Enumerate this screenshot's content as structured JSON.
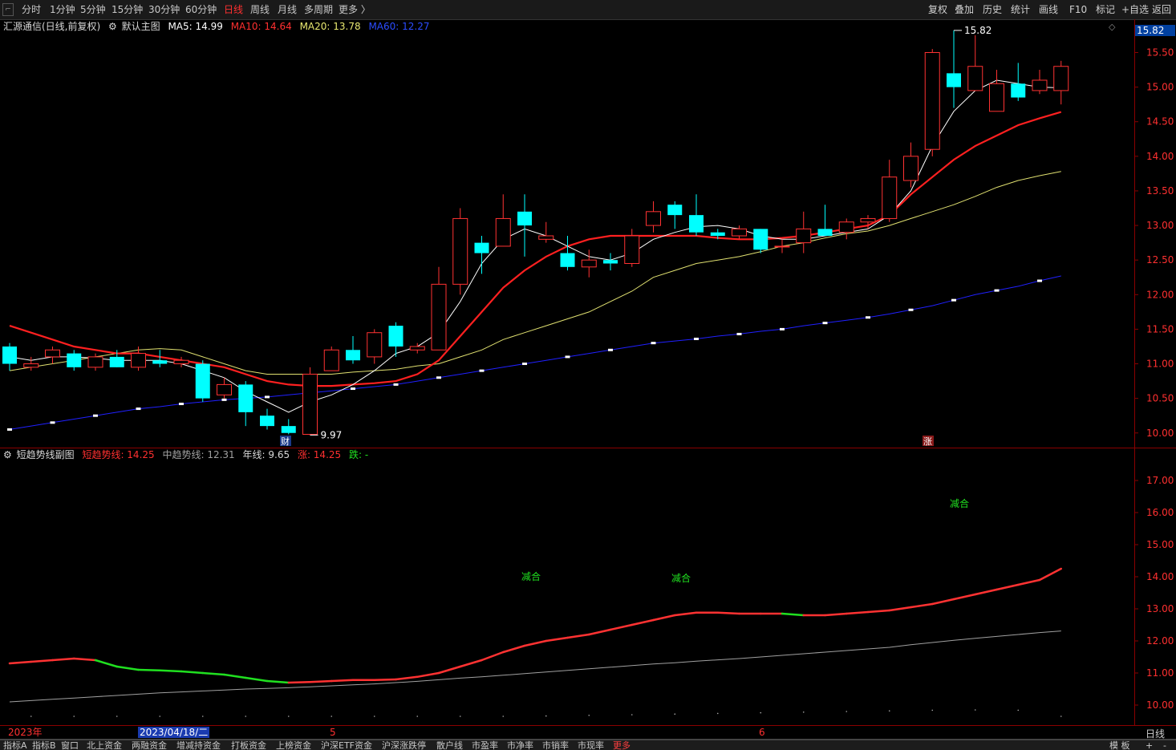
{
  "periods": [
    "分时",
    "1分钟",
    "5分钟",
    "15分钟",
    "30分钟",
    "60分钟",
    "日线",
    "周线",
    "月线",
    "多周期",
    "更多 〉"
  ],
  "active_period": "日线",
  "tools": [
    "复权",
    "叠加",
    "历史",
    "统计",
    "画线",
    "F10",
    "标记",
    "+自选",
    "返回"
  ],
  "main_info": {
    "title": "汇源通信(日线,前复权)",
    "template": "默认主图",
    "ma5": "MA5: 14.99",
    "ma10": "MA10: 14.64",
    "ma20": "MA20: 13.78",
    "ma60": "MA60: 12.27"
  },
  "sub_info": {
    "title": "短趋势线副图",
    "short": "短趋势线: 14.25",
    "mid": "中趋势线: 12.31",
    "year": "年线: 9.65",
    "up": "涨: 14.25",
    "down": "跌: -"
  },
  "last_price": "15.82",
  "high_mark": "15.82",
  "low_mark": "9.97",
  "event_markers": [
    {
      "label": "财",
      "type": "financial"
    },
    {
      "label": "涨",
      "type": "limit-up"
    }
  ],
  "sub_annotations": [
    "减合",
    "减合",
    "减合"
  ],
  "colors": {
    "up": "#ff3232",
    "down": "#00ffff",
    "ma5": "#ffffff",
    "ma10": "#ff2020",
    "ma20": "#e0e070",
    "ma60": "#2020ff",
    "green": "#20e020",
    "grid": "#8b0000"
  },
  "main_axis_ticks": [
    "15.50",
    "15.00",
    "14.50",
    "14.00",
    "13.50",
    "13.00",
    "12.50",
    "12.00",
    "11.50",
    "11.00",
    "10.50",
    "10.00"
  ],
  "sub_axis_ticks": [
    "17.00",
    "16.00",
    "15.00",
    "14.00",
    "13.00",
    "12.00",
    "11.00",
    "10.00"
  ],
  "date_axis": {
    "year": "2023年",
    "cursor": "2023/04/18/二",
    "month5": "5",
    "month6": "6"
  },
  "period_label": "日线",
  "bottom_tabs": [
    "指标A",
    "指标B",
    "窗口",
    "北上资金",
    "两融资金",
    "增减持资金",
    "打板资金",
    "上榜资金",
    "沪深ETF资金",
    "沪深涨跌停",
    "散户线",
    "市盈率",
    "市净率",
    "市销率",
    "市现率",
    "更多"
  ],
  "bottom_right": [
    "模 板",
    "+",
    "-"
  ],
  "chart_data": [
    {
      "type": "candlestick",
      "title": "汇源通信(日线,前复权)",
      "ylim": [
        9.8,
        15.9
      ],
      "candles": [
        {
          "o": 11.25,
          "c": 11.0,
          "h": 11.3,
          "l": 10.9
        },
        {
          "o": 10.95,
          "c": 11.0,
          "h": 11.1,
          "l": 10.9
        },
        {
          "o": 11.1,
          "c": 11.2,
          "h": 11.25,
          "l": 11.0
        },
        {
          "o": 11.15,
          "c": 10.95,
          "h": 11.2,
          "l": 10.9
        },
        {
          "o": 10.95,
          "c": 11.1,
          "h": 11.15,
          "l": 10.9
        },
        {
          "o": 11.1,
          "c": 10.95,
          "h": 11.2,
          "l": 10.95
        },
        {
          "o": 10.95,
          "c": 11.15,
          "h": 11.25,
          "l": 10.9
        },
        {
          "o": 11.05,
          "c": 11.0,
          "h": 11.2,
          "l": 10.95
        },
        {
          "o": 11.0,
          "c": 11.05,
          "h": 11.1,
          "l": 10.95
        },
        {
          "o": 11.0,
          "c": 10.5,
          "h": 11.05,
          "l": 10.45
        },
        {
          "o": 10.55,
          "c": 10.7,
          "h": 10.8,
          "l": 10.5
        },
        {
          "o": 10.7,
          "c": 10.3,
          "h": 10.75,
          "l": 10.1
        },
        {
          "o": 10.25,
          "c": 10.1,
          "h": 10.35,
          "l": 10.05
        },
        {
          "o": 10.1,
          "c": 10.0,
          "h": 10.2,
          "l": 9.98
        },
        {
          "o": 9.98,
          "c": 10.85,
          "h": 10.95,
          "l": 9.97
        },
        {
          "o": 10.9,
          "c": 11.2,
          "h": 11.25,
          "l": 10.9
        },
        {
          "o": 11.2,
          "c": 11.05,
          "h": 11.4,
          "l": 11.0
        },
        {
          "o": 11.1,
          "c": 11.45,
          "h": 11.5,
          "l": 11.0
        },
        {
          "o": 11.55,
          "c": 11.25,
          "h": 11.6,
          "l": 11.1
        },
        {
          "o": 11.2,
          "c": 11.25,
          "h": 11.3,
          "l": 11.15
        },
        {
          "o": 11.2,
          "c": 12.15,
          "h": 12.4,
          "l": 11.2
        },
        {
          "o": 12.15,
          "c": 13.1,
          "h": 13.25,
          "l": 12.0
        },
        {
          "o": 12.75,
          "c": 12.6,
          "h": 12.85,
          "l": 12.3
        },
        {
          "o": 12.7,
          "c": 13.1,
          "h": 13.45,
          "l": 12.7
        },
        {
          "o": 13.2,
          "c": 13.0,
          "h": 13.45,
          "l": 12.55
        },
        {
          "o": 12.8,
          "c": 12.85,
          "h": 13.05,
          "l": 12.75
        },
        {
          "o": 12.6,
          "c": 12.4,
          "h": 12.85,
          "l": 12.35
        },
        {
          "o": 12.4,
          "c": 12.5,
          "h": 12.65,
          "l": 12.25
        },
        {
          "o": 12.5,
          "c": 12.45,
          "h": 12.6,
          "l": 12.35
        },
        {
          "o": 12.45,
          "c": 12.85,
          "h": 12.95,
          "l": 12.4
        },
        {
          "o": 13.0,
          "c": 13.2,
          "h": 13.35,
          "l": 12.9
        },
        {
          "o": 13.3,
          "c": 13.15,
          "h": 13.35,
          "l": 12.95
        },
        {
          "o": 13.15,
          "c": 12.9,
          "h": 13.45,
          "l": 12.85
        },
        {
          "o": 12.9,
          "c": 12.85,
          "h": 12.95,
          "l": 12.8
        },
        {
          "o": 12.85,
          "c": 12.95,
          "h": 13.0,
          "l": 12.8
        },
        {
          "o": 12.95,
          "c": 12.65,
          "h": 12.95,
          "l": 12.6
        },
        {
          "o": 12.7,
          "c": 12.7,
          "h": 12.8,
          "l": 12.6
        },
        {
          "o": 12.75,
          "c": 12.95,
          "h": 13.2,
          "l": 12.6
        },
        {
          "o": 12.95,
          "c": 12.85,
          "h": 13.3,
          "l": 12.85
        },
        {
          "o": 12.9,
          "c": 13.05,
          "h": 13.1,
          "l": 12.8
        },
        {
          "o": 13.05,
          "c": 13.1,
          "h": 13.15,
          "l": 12.95
        },
        {
          "o": 13.1,
          "c": 13.7,
          "h": 13.95,
          "l": 13.05
        },
        {
          "o": 13.65,
          "c": 14.0,
          "h": 14.2,
          "l": 13.55
        },
        {
          "o": 14.1,
          "c": 15.5,
          "h": 15.55,
          "l": 14.0
        },
        {
          "o": 15.2,
          "c": 15.0,
          "h": 15.82,
          "l": 14.7
        },
        {
          "o": 14.95,
          "c": 15.3,
          "h": 15.75,
          "l": 14.95
        },
        {
          "o": 14.65,
          "c": 15.05,
          "h": 15.25,
          "l": 14.65
        },
        {
          "o": 15.05,
          "c": 14.85,
          "h": 15.35,
          "l": 14.8
        },
        {
          "o": 14.95,
          "c": 15.1,
          "h": 15.25,
          "l": 14.9
        },
        {
          "o": 14.95,
          "c": 15.3,
          "h": 15.38,
          "l": 14.75
        }
      ],
      "ma5": [
        11.1,
        11.05,
        11.1,
        11.1,
        11.08,
        11.05,
        11.05,
        11.05,
        11.0,
        10.9,
        10.8,
        10.6,
        10.45,
        10.3,
        10.45,
        10.55,
        10.7,
        10.9,
        11.15,
        11.25,
        11.45,
        11.9,
        12.45,
        12.8,
        12.95,
        12.85,
        12.7,
        12.55,
        12.5,
        12.6,
        12.8,
        12.9,
        12.98,
        13.0,
        12.95,
        12.85,
        12.8,
        12.8,
        12.85,
        12.9,
        12.95,
        13.15,
        13.5,
        14.15,
        14.65,
        14.95,
        15.1,
        15.05,
        15.0,
        14.99
      ],
      "ma10": [
        11.55,
        11.45,
        11.35,
        11.25,
        11.2,
        11.15,
        11.15,
        11.1,
        11.05,
        11.0,
        10.95,
        10.85,
        10.75,
        10.7,
        10.68,
        10.68,
        10.7,
        10.72,
        10.75,
        10.85,
        11.05,
        11.4,
        11.75,
        12.1,
        12.35,
        12.55,
        12.7,
        12.8,
        12.85,
        12.85,
        12.85,
        12.85,
        12.85,
        12.82,
        12.8,
        12.8,
        12.82,
        12.85,
        12.9,
        12.95,
        13.0,
        13.15,
        13.45,
        13.7,
        13.95,
        14.15,
        14.3,
        14.45,
        14.55,
        14.64
      ],
      "ma20": [
        10.9,
        10.95,
        11.0,
        11.05,
        11.1,
        11.15,
        11.2,
        11.22,
        11.2,
        11.1,
        11.0,
        10.9,
        10.85,
        10.85,
        10.85,
        10.85,
        10.88,
        10.9,
        10.92,
        10.97,
        11.0,
        11.1,
        11.2,
        11.35,
        11.45,
        11.55,
        11.65,
        11.75,
        11.9,
        12.05,
        12.25,
        12.35,
        12.45,
        12.5,
        12.55,
        12.62,
        12.7,
        12.75,
        12.82,
        12.88,
        12.92,
        13.0,
        13.1,
        13.2,
        13.3,
        13.42,
        13.55,
        13.65,
        13.72,
        13.78
      ],
      "ma60": [
        10.05,
        10.1,
        10.15,
        10.2,
        10.25,
        10.3,
        10.35,
        10.38,
        10.42,
        10.45,
        10.48,
        10.5,
        10.52,
        10.55,
        10.58,
        10.61,
        10.64,
        10.67,
        10.7,
        10.75,
        10.8,
        10.85,
        10.9,
        10.95,
        11.0,
        11.05,
        11.1,
        11.15,
        11.2,
        11.25,
        11.3,
        11.33,
        11.36,
        11.4,
        11.43,
        11.47,
        11.5,
        11.55,
        11.59,
        11.63,
        11.67,
        11.72,
        11.78,
        11.84,
        11.92,
        12.0,
        12.06,
        12.12,
        12.2,
        12.27
      ]
    },
    {
      "type": "line",
      "title": "短趋势线副图",
      "ylim": [
        9.6,
        17.6
      ],
      "series": [
        {
          "name": "短趋势线",
          "values": [
            11.3,
            11.35,
            11.4,
            11.45,
            11.4,
            11.2,
            11.1,
            11.08,
            11.05,
            11.0,
            10.95,
            10.85,
            10.75,
            10.7,
            10.72,
            10.75,
            10.78,
            10.78,
            10.8,
            10.88,
            11.0,
            11.2,
            11.4,
            11.65,
            11.85,
            12.0,
            12.1,
            12.2,
            12.35,
            12.5,
            12.65,
            12.8,
            12.88,
            12.88,
            12.85,
            12.85,
            12.85,
            12.8,
            12.8,
            12.85,
            12.9,
            12.95,
            13.05,
            13.15,
            13.3,
            13.45,
            13.6,
            13.75,
            13.9,
            14.25
          ],
          "down_ranges": [
            [
              4,
              13
            ],
            [
              36,
              37
            ]
          ]
        },
        {
          "name": "中趋势线",
          "values": [
            10.1,
            10.14,
            10.18,
            10.22,
            10.26,
            10.3,
            10.34,
            10.38,
            10.41,
            10.44,
            10.47,
            10.5,
            10.52,
            10.54,
            10.57,
            10.6,
            10.63,
            10.66,
            10.7,
            10.74,
            10.79,
            10.84,
            10.88,
            10.93,
            10.98,
            11.03,
            11.08,
            11.13,
            11.18,
            11.23,
            11.28,
            11.32,
            11.37,
            11.41,
            11.45,
            11.5,
            11.55,
            11.6,
            11.65,
            11.7,
            11.75,
            11.8,
            11.88,
            11.95,
            12.02,
            12.08,
            12.14,
            12.2,
            12.26,
            12.31
          ]
        },
        {
          "name": "年线",
          "values": [
            9.2,
            9.22,
            9.24,
            9.26,
            9.28,
            9.3,
            9.32,
            9.34,
            9.36,
            9.38,
            9.4,
            9.42,
            9.44,
            9.46,
            9.48,
            9.5,
            9.52,
            9.54,
            9.56,
            9.58,
            9.6,
            9.62,
            9.63,
            9.64,
            9.65,
            9.66,
            9.67,
            9.68,
            9.69,
            9.7,
            9.71,
            9.72,
            9.73,
            9.74,
            9.75,
            9.76,
            9.77,
            9.78,
            9.79,
            9.8,
            9.81,
            9.82,
            9.83,
            9.84,
            9.85,
            9.85,
            9.85,
            9.84,
            9.8,
            9.65
          ]
        }
      ]
    }
  ]
}
